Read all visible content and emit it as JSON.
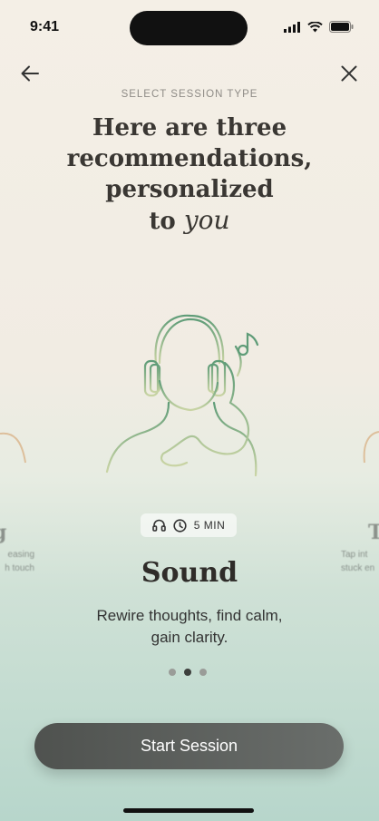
{
  "status": {
    "time": "9:41"
  },
  "header": {
    "eyebrow": "SELECT SESSION TYPE",
    "headline_line1": "Here are three",
    "headline_line2": "recommendations,",
    "headline_line3": "personalized",
    "headline_to": "to",
    "headline_script": "you"
  },
  "card": {
    "duration": "5 MIN",
    "title": "Sound",
    "description_line1": "Rewire thoughts, find calm,",
    "description_line2": "gain clarity.",
    "illustration": "person-with-headphones"
  },
  "ghost_left": {
    "title": "g",
    "sub_line1": "easing",
    "sub_line2": "h touch"
  },
  "ghost_right": {
    "title": "T",
    "sub_line1": "Tap int",
    "sub_line2": "stuck en"
  },
  "pagination": {
    "count": 3,
    "active": 2
  },
  "cta": {
    "label": "Start Session"
  },
  "colors": {
    "accent_green": "#6aa57f",
    "button": "#5a5d5a"
  }
}
